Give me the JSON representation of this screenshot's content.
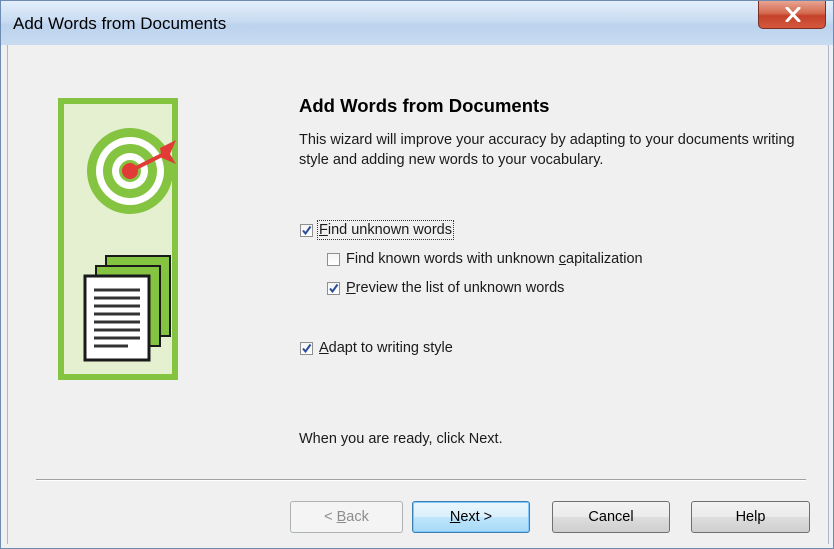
{
  "window": {
    "title": "Add Words from Documents",
    "close_glyph": "X"
  },
  "wizard": {
    "heading": "Add Words from Documents",
    "description": "This wizard will improve your accuracy by adapting to your documents writing style and adding new words to your vocabulary.",
    "ready_text": "When you are ready, click Next."
  },
  "options": {
    "find_unknown": {
      "accel": "F",
      "rest": "ind unknown words",
      "checked": true
    },
    "find_capitalization": {
      "before": "Find known words with unknown ",
      "accel": "c",
      "after": "apitalization",
      "checked": false
    },
    "preview_list": {
      "accel": "P",
      "rest": "review the list of unknown words",
      "checked": true
    },
    "adapt_style": {
      "accel": "A",
      "rest": "dapt to writing style",
      "checked": true
    }
  },
  "buttons": {
    "back": {
      "prefix": "< ",
      "accel": "B",
      "rest": "ack",
      "enabled": false
    },
    "next": {
      "accel": "N",
      "rest": "ext >"
    },
    "cancel": "Cancel",
    "help": "Help"
  },
  "icons": {
    "illustration": "target-and-documents-icon",
    "close": "close-icon",
    "checkmark": "checkmark-icon"
  },
  "colors": {
    "illustration_green": "#84c441",
    "illustration_bg": "#e4f0d0",
    "dart_red": "#e23a37",
    "close_red": "#c4412a",
    "title_bar": "#c9dcf2",
    "check_blue": "#2a4d9b"
  }
}
